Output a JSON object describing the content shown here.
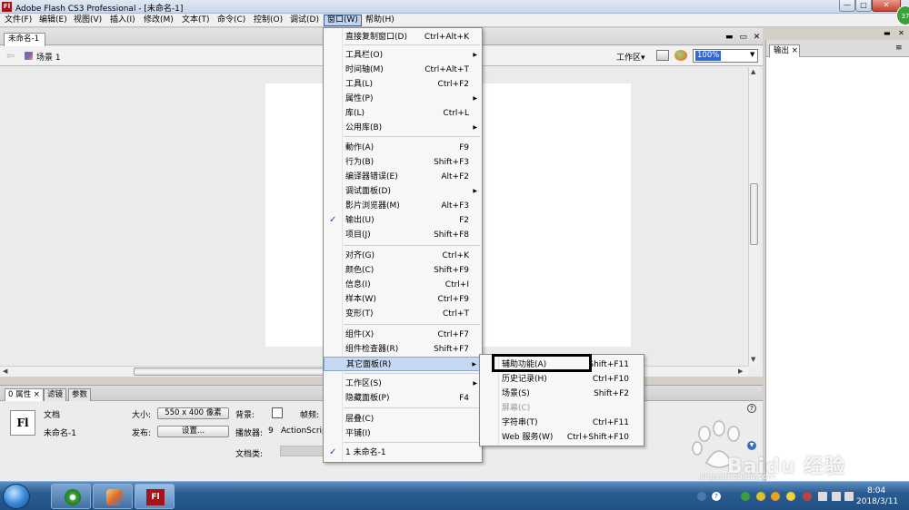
{
  "window": {
    "title": "Adobe Flash CS3 Professional - [未命名-1]",
    "logo": "Fl",
    "min": "—",
    "max": "□",
    "close": "✕"
  },
  "menubar": [
    "文件(F)",
    "编辑(E)",
    "视图(V)",
    "插入(I)",
    "修改(M)",
    "文本(T)",
    "命令(C)",
    "控制(O)",
    "调试(D)",
    "窗口(W)",
    "帮助(H)"
  ],
  "document": {
    "tab": "未命名-1",
    "controls": "▬ ▭ ✕",
    "scene": "场景 1",
    "workspace": "工作区▾",
    "zoom": "100%"
  },
  "window_menu": [
    {
      "label": "直接复制窗口(D)",
      "shortcut": "Ctrl+Alt+K",
      "submenu": false,
      "checked": false
    },
    {
      "label": "工具栏(O)",
      "shortcut": "",
      "submenu": true,
      "checked": false
    },
    {
      "label": "时间轴(M)",
      "shortcut": "Ctrl+Alt+T",
      "submenu": false,
      "checked": false
    },
    {
      "label": "工具(L)",
      "shortcut": "Ctrl+F2",
      "submenu": false,
      "checked": false
    },
    {
      "label": "属性(P)",
      "shortcut": "",
      "submenu": true,
      "checked": false
    },
    {
      "label": "库(L)",
      "shortcut": "Ctrl+L",
      "submenu": false,
      "checked": false
    },
    {
      "label": "公用库(B)",
      "shortcut": "",
      "submenu": true,
      "checked": false
    },
    {
      "label": "動作(A)",
      "shortcut": "F9",
      "submenu": false,
      "checked": false
    },
    {
      "label": "行为(B)",
      "shortcut": "Shift+F3",
      "submenu": false,
      "checked": false
    },
    {
      "label": "编译器错误(E)",
      "shortcut": "Alt+F2",
      "submenu": false,
      "checked": false
    },
    {
      "label": "调试面板(D)",
      "shortcut": "",
      "submenu": true,
      "checked": false
    },
    {
      "label": "影片浏览器(M)",
      "shortcut": "Alt+F3",
      "submenu": false,
      "checked": false
    },
    {
      "label": "输出(U)",
      "shortcut": "F2",
      "submenu": false,
      "checked": true
    },
    {
      "label": "项目(J)",
      "shortcut": "Shift+F8",
      "submenu": false,
      "checked": false
    },
    {
      "label": "对齐(G)",
      "shortcut": "Ctrl+K",
      "submenu": false,
      "checked": false
    },
    {
      "label": "颜色(C)",
      "shortcut": "Shift+F9",
      "submenu": false,
      "checked": false
    },
    {
      "label": "信息(I)",
      "shortcut": "Ctrl+I",
      "submenu": false,
      "checked": false
    },
    {
      "label": "样本(W)",
      "shortcut": "Ctrl+F9",
      "submenu": false,
      "checked": false
    },
    {
      "label": "变形(T)",
      "shortcut": "Ctrl+T",
      "submenu": false,
      "checked": false
    },
    {
      "label": "组件(X)",
      "shortcut": "Ctrl+F7",
      "submenu": false,
      "checked": false
    },
    {
      "label": "组件检查器(R)",
      "shortcut": "Shift+F7",
      "submenu": false,
      "checked": false
    },
    {
      "label": "其它面板(R)",
      "shortcut": "",
      "submenu": true,
      "checked": false,
      "highlighted": true
    },
    {
      "label": "工作区(S)",
      "shortcut": "",
      "submenu": true,
      "checked": false
    },
    {
      "label": "隐藏面板(P)",
      "shortcut": "F4",
      "submenu": false,
      "checked": false
    },
    {
      "label": "层叠(C)",
      "shortcut": "",
      "submenu": false,
      "checked": false
    },
    {
      "label": "平铺(I)",
      "shortcut": "",
      "submenu": false,
      "checked": false
    },
    {
      "label": "1 未命名-1",
      "shortcut": "",
      "submenu": false,
      "checked": true
    }
  ],
  "other_panels_submenu": [
    {
      "label": "辅助功能(A)",
      "shortcut": "Shift+F11",
      "disabled": false
    },
    {
      "label": "历史记录(H)",
      "shortcut": "Ctrl+F10",
      "disabled": false
    },
    {
      "label": "场景(S)",
      "shortcut": "Shift+F2",
      "disabled": false
    },
    {
      "label": "屏幕(C)",
      "shortcut": "",
      "disabled": true
    },
    {
      "label": "字符串(T)",
      "shortcut": "Ctrl+F11",
      "disabled": false
    },
    {
      "label": "Web 服务(W)",
      "shortcut": "Ctrl+Shift+F10",
      "disabled": false
    }
  ],
  "properties": {
    "tabs": [
      "0 属性 ×",
      "滤镜",
      "参数"
    ],
    "doc_type": "文档",
    "doc_name": "未命名-1",
    "size_label": "大小:",
    "size_value": "550 x 400 像素",
    "bg_label": "背景:",
    "fps_label": "帧频:",
    "publish_label": "发布:",
    "settings_button": "设置...",
    "player_label": "播放器:",
    "player_value": "9",
    "actionscript_label": "ActionScript:",
    "doc_class_label": "文档类:",
    "fl_icon": "Fl",
    "help": "?"
  },
  "output_panel": {
    "tab": "输出 ×",
    "menu_icon": "≡"
  },
  "taskbar": {
    "time": "8:04",
    "date": "2018/3/11",
    "flash_icon": "Fl"
  },
  "badge": "37",
  "watermark": {
    "text": "Baidu 经验",
    "url": "jingyan.baidu.com"
  }
}
